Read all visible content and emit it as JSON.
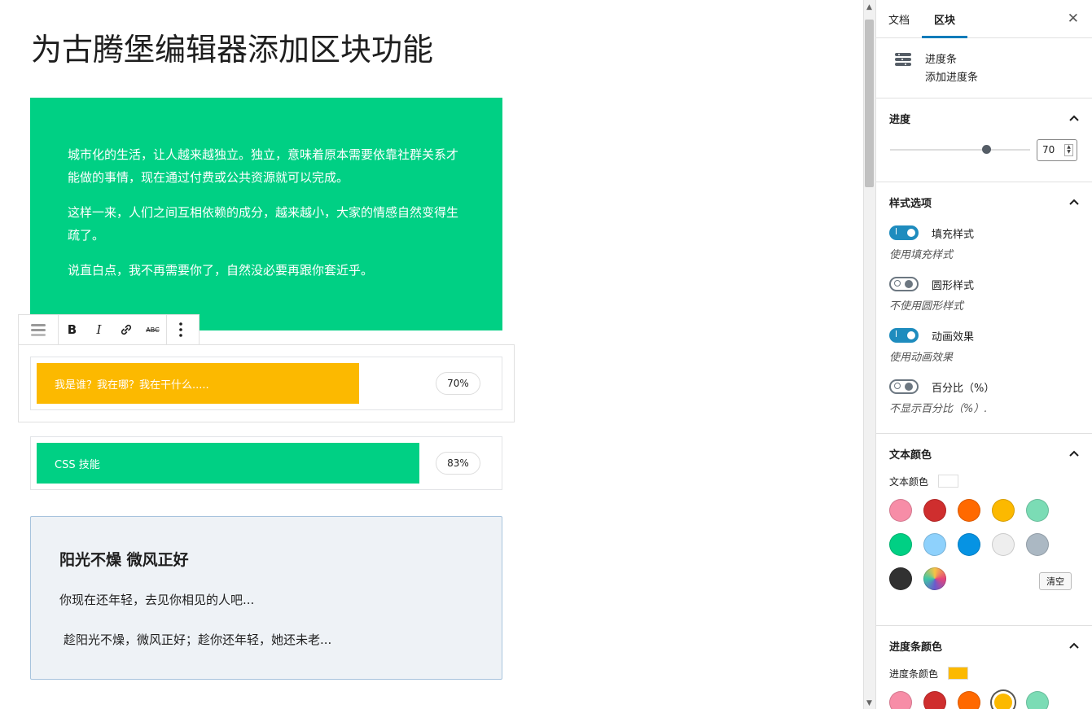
{
  "post_title": "为古腾堡编辑器添加区块功能",
  "group_block": {
    "paragraphs": [
      "城市化的生活，让人越来越独立。独立，意味着原本需要依靠社群关系才能做的事情，现在通过付费或公共资源就可以完成。",
      "这样一来，人们之间互相依赖的成分，越来越小，大家的情感自然变得生疏了。",
      "说直白点，我不再需要你了，自然没必要再跟你套近乎。"
    ],
    "color": "#00d084"
  },
  "toolbar": {
    "block_type_icon": "progress-bar-icon",
    "bold_label": "B",
    "italic_label": "I",
    "link_icon": "link-icon",
    "strikethrough_label": "ABC",
    "more_icon": "more-vertical-icon"
  },
  "progress_bars": [
    {
      "label": "我是谁？我在哪？我在干什么.....",
      "percent": 70,
      "percent_label": "70%",
      "color": "#fcb900"
    },
    {
      "label": "CSS 技能",
      "percent": 83,
      "percent_label": "83%",
      "color": "#00d084"
    }
  ],
  "card": {
    "title": "阳光不燥 微风正好",
    "line1": "你现在还年轻，去见你相见的人吧...",
    "line2": "趁阳光不燥，微风正好；趁你还年轻，她还未老..."
  },
  "sidebar": {
    "tabs": [
      "文档",
      "区块"
    ],
    "active_tab": "区块",
    "close_icon": "close-icon",
    "block_info": {
      "icon": "progress-bar-icon",
      "name": "进度条",
      "description": "添加进度条"
    },
    "progress_panel": {
      "title": "进度",
      "value": "70",
      "range_value": 70,
      "range_max": 100
    },
    "style_panel": {
      "title": "样式选项",
      "toggles": [
        {
          "label": "填充样式",
          "help": "使用填充样式",
          "on": true
        },
        {
          "label": "圆形样式",
          "help": "不使用圆形样式",
          "on": false
        },
        {
          "label": "动画效果",
          "help": "使用动画效果",
          "on": true
        },
        {
          "label": "百分比（%）",
          "help": "不显示百分比（%）.",
          "on": false
        }
      ]
    },
    "text_color_panel": {
      "title": "文本颜色",
      "label": "文本颜色",
      "current": "#ffffff",
      "palette": [
        "#f78da7",
        "#cf2e2e",
        "#ff6900",
        "#fcb900",
        "#7bdcb5",
        "#00d084",
        "#8ed1fc",
        "#0693e3",
        "#eeeeee",
        "#abb8c3",
        "#313131",
        "gradient"
      ],
      "clear_label": "清空"
    },
    "bar_color_panel": {
      "title": "进度条颜色",
      "label": "进度条颜色",
      "current": "#fcb900",
      "palette": [
        "#f78da7",
        "#cf2e2e",
        "#ff6900",
        "#fcb900",
        "#7bdcb5"
      ]
    }
  }
}
